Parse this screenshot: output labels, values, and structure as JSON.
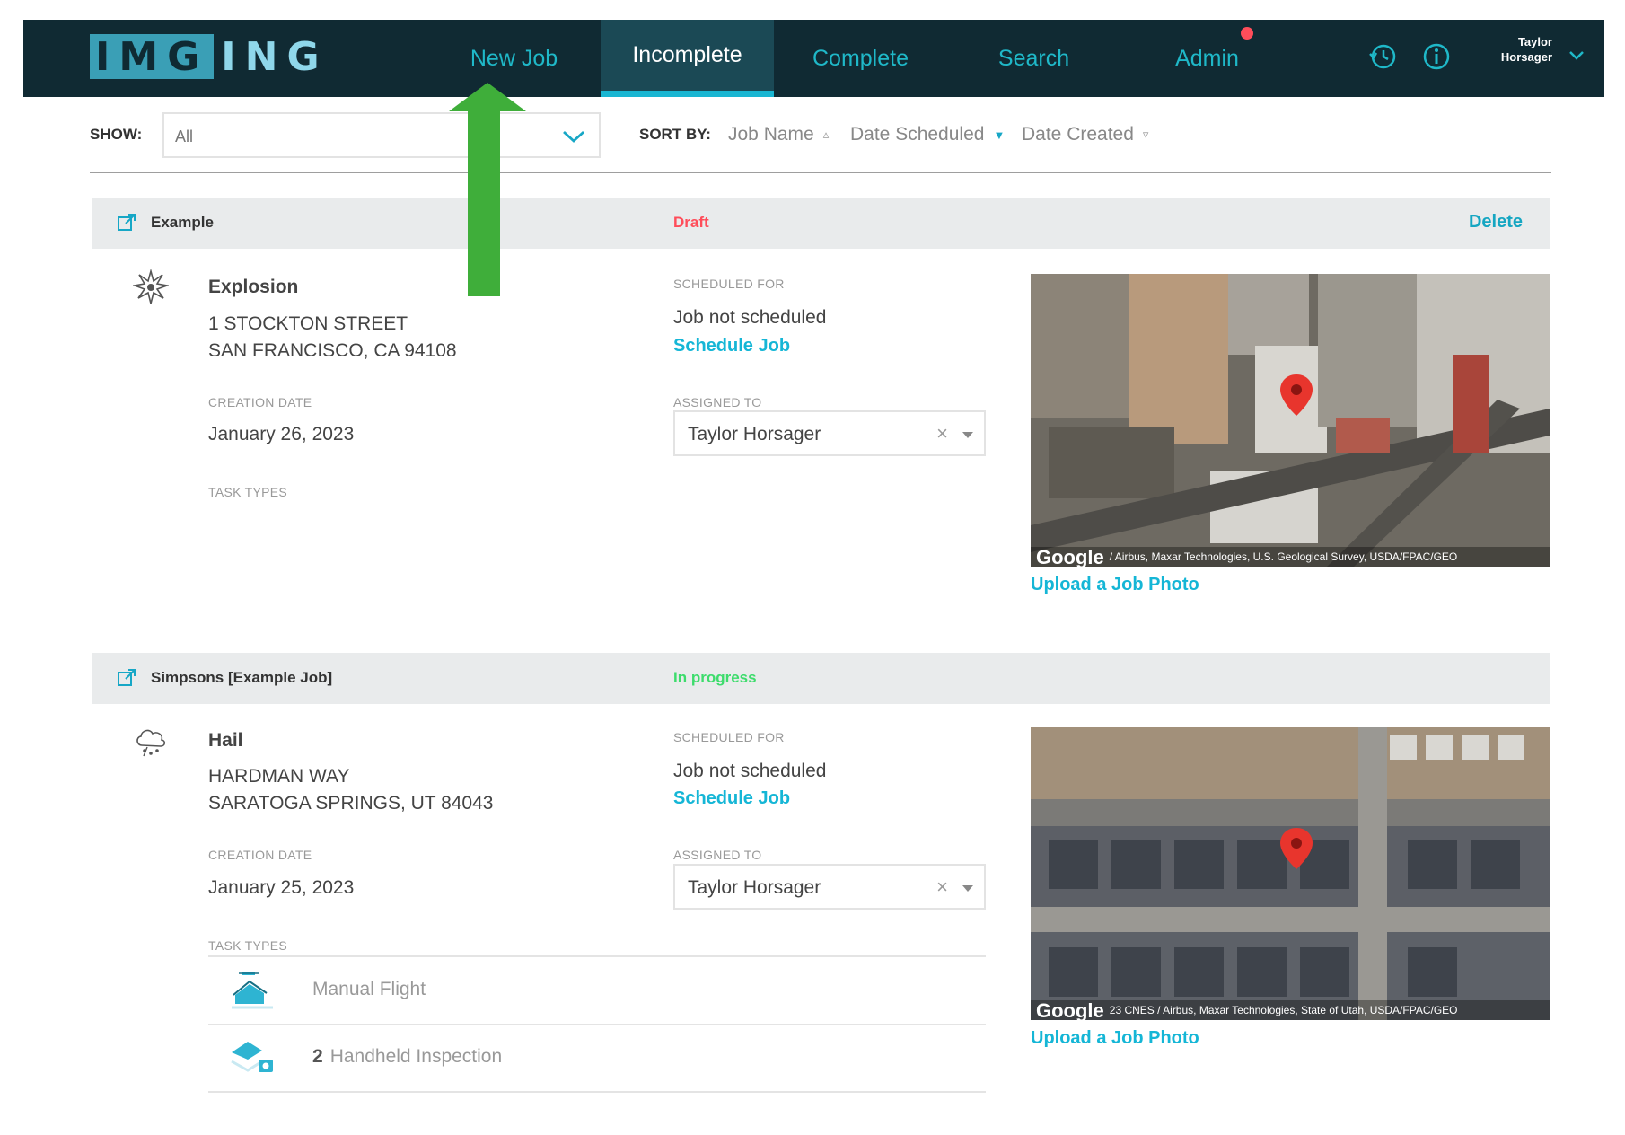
{
  "header": {
    "logo_left": "IMG",
    "logo_right": "NG",
    "nav": [
      {
        "label": "New Job",
        "active": false
      },
      {
        "label": "Incomplete",
        "active": true
      },
      {
        "label": "Complete",
        "active": false
      },
      {
        "label": "Search",
        "active": false
      },
      {
        "label": "Admin",
        "active": false
      }
    ],
    "user_first": "Taylor",
    "user_last": "Horsager",
    "icons": [
      "history-icon",
      "info-icon",
      "chevron-down-icon"
    ]
  },
  "filters": {
    "show_label": "SHOW:",
    "show_value": "All",
    "sort_label": "SORT BY:",
    "sort_options": [
      {
        "label": "Job Name",
        "arrow": "▵",
        "active": false
      },
      {
        "label": "Date Scheduled",
        "arrow": "▼",
        "active": true
      },
      {
        "label": "Date Created",
        "arrow": "▿",
        "active": false
      }
    ]
  },
  "jobs": [
    {
      "name": "Example",
      "status": "Draft",
      "status_color": "#ff4d5a",
      "delete_label": "Delete",
      "type": "Explosion",
      "type_icon": "explosion-icon",
      "address_line1": "1 STOCKTON STREET",
      "address_line2": "SAN FRANCISCO, CA 94108",
      "creation_label": "CREATION DATE",
      "creation_date": "January 26, 2023",
      "task_types_label": "TASK TYPES",
      "scheduled_label": "SCHEDULED FOR",
      "scheduled_value": "Job not scheduled",
      "schedule_link": "Schedule Job",
      "assigned_label": "ASSIGNED TO",
      "assigned_value": "Taylor Horsager",
      "map_brand": "Google",
      "map_credit": "/ Airbus, Maxar Technologies, U.S. Geological Survey, USDA/FPAC/GEO",
      "upload_label": "Upload a Job Photo"
    },
    {
      "name": "Simpsons [Example Job]",
      "status": "In progress",
      "status_color": "#3ddc6c",
      "type": "Hail",
      "type_icon": "hail-icon",
      "address_line1": "HARDMAN WAY",
      "address_line2": "SARATOGA SPRINGS, UT 84043",
      "creation_label": "CREATION DATE",
      "creation_date": "January 25, 2023",
      "task_types_label": "TASK TYPES",
      "scheduled_label": "SCHEDULED FOR",
      "scheduled_value": "Job not scheduled",
      "schedule_link": "Schedule Job",
      "assigned_label": "ASSIGNED TO",
      "assigned_value": "Taylor Horsager",
      "map_brand": "Google",
      "map_credit": "23 CNES / Airbus, Maxar Technologies, State of Utah, USDA/FPAC/GEO",
      "upload_label": "Upload a Job Photo",
      "tasks": [
        {
          "count": "",
          "label": "Manual Flight",
          "icon": "drone-house-icon"
        },
        {
          "count": "2",
          "label": "Handheld Inspection",
          "icon": "handheld-camera-icon"
        }
      ]
    }
  ],
  "colors": {
    "header_bg": "#102a33",
    "accent": "#15b6d6",
    "annotation_arrow": "#3fae3a"
  }
}
